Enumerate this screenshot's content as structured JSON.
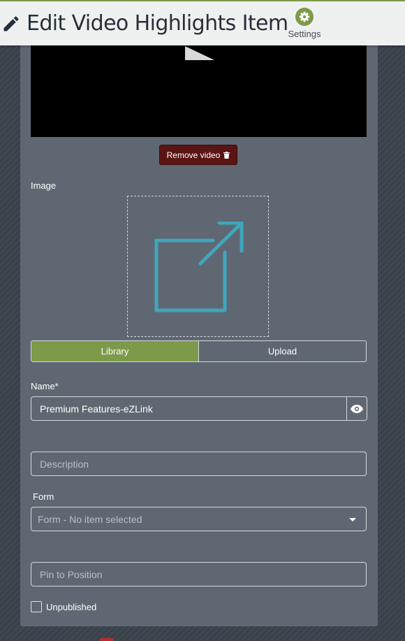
{
  "header": {
    "title": "Edit Video Highlights Item",
    "settings_label": "Settings"
  },
  "video": {
    "remove_label": "Remove video"
  },
  "image": {
    "label": "Image",
    "tabs": [
      {
        "label": "Library",
        "active": true
      },
      {
        "label": "Upload",
        "active": false
      }
    ]
  },
  "name": {
    "label": "Name*",
    "value": "Premium Features-eZLink"
  },
  "description": {
    "placeholder": "Description"
  },
  "form": {
    "label": "Form",
    "selected": "Form - No item selected"
  },
  "pin": {
    "placeholder": "Pin to Position"
  },
  "unpublished": {
    "label": "Unpublished",
    "checked": false
  },
  "colors": {
    "accent": "#7d9a4a",
    "danger": "#5a1414",
    "icon_teal": "#3fa6bd",
    "panel": "#5f6872"
  },
  "icons": {
    "header": "pencil-icon",
    "settings": "gear-icon",
    "remove": "trash-icon",
    "image_placeholder": "external-link-icon",
    "visibility": "eye-icon",
    "dropdown": "chevron-down-icon"
  }
}
